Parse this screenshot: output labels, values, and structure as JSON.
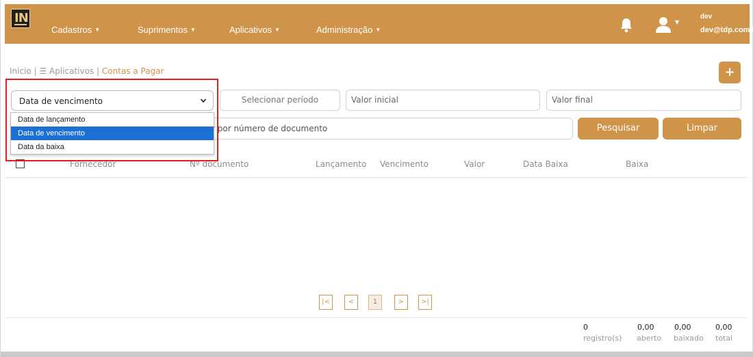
{
  "header": {
    "logo_text": "IN",
    "nav": [
      {
        "label": "Cadastros"
      },
      {
        "label": "Suprimentos"
      },
      {
        "label": "Aplicativos"
      },
      {
        "label": "Administração"
      }
    ],
    "user": {
      "name": "dev",
      "email": "dev@tdp.com.br"
    },
    "accent_color": "#cf944a"
  },
  "breadcrumb": {
    "home": "Inicio |",
    "apps": "Aplicativos |",
    "current": "Contas a Pagar"
  },
  "add_button": {
    "label": "+"
  },
  "filters": {
    "date_type": {
      "selected": "Data de vencimento",
      "options": [
        "Data de lançamento",
        "Data de vencimento",
        "Data da baixa"
      ],
      "highlighted_option": "Data de vencimento"
    },
    "period_placeholder": "Selecionar período",
    "valor_inicial_placeholder": "Valor inicial",
    "valor_final_placeholder": "Valor final",
    "document_placeholder": "r por número de documento",
    "search_label": "Pesquisar",
    "clear_label": "Limpar"
  },
  "table": {
    "columns": [
      "Fornecedor",
      "Nº documento",
      "Lançamento",
      "Vencimento",
      "Valor",
      "Data Baixa",
      "Baixa"
    ],
    "rows": []
  },
  "pagination": {
    "first": "|<",
    "prev": "<",
    "current": "1",
    "next": ">",
    "last": ">|"
  },
  "totals": [
    {
      "value": "0",
      "label": "registro(s)"
    },
    {
      "value": "0,00",
      "label": "aberto"
    },
    {
      "value": "0,00",
      "label": "baixado"
    },
    {
      "value": "0,00",
      "label": "total"
    }
  ]
}
